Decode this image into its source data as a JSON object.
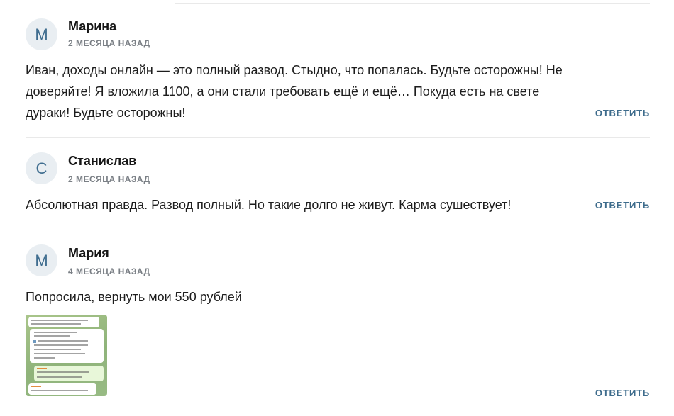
{
  "comments": [
    {
      "avatar_letter": "М",
      "author": "Марина",
      "date": "2 МЕСЯЦА НАЗАД",
      "lines": [
        "Иван, доходы онлайн — это полный развод. Стыдно, что попалась. Будьте осторожны! Не",
        "доверяйте! Я вложила 1100, а они стали требовать ещё и ещё… Покуда есть на свете",
        "дураки! Будьте осторожны!"
      ],
      "reply_label": "ОТВЕТИТЬ"
    },
    {
      "avatar_letter": "С",
      "author": "Станислав",
      "date": "2 МЕСЯЦА НАЗАД",
      "lines": [
        "Абсолютная правда. Развод полный. Но такие долго не живут. Карма сушествует!"
      ],
      "reply_label": "ОТВЕТИТЬ"
    },
    {
      "avatar_letter": "М",
      "author": "Мария",
      "date": "4 МЕСЯЦА НАЗАД",
      "lines": [
        "Попросила, вернуть мои 550 рублей"
      ],
      "reply_label": "ОТВЕТИТЬ",
      "attachment_icon": "chat-screenshot-thumbnail"
    }
  ]
}
